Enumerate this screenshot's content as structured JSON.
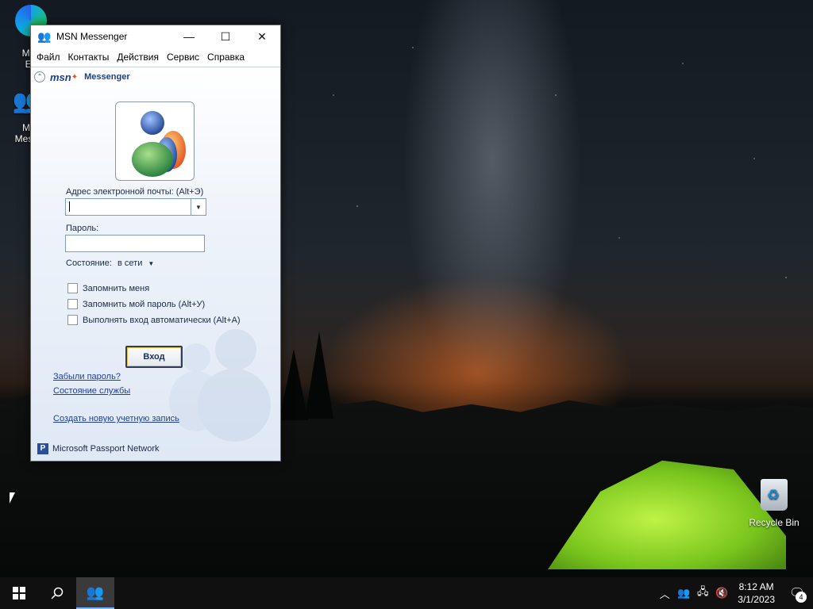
{
  "desktop": {
    "icons": [
      {
        "label": "Micr… Ed…",
        "line1": "Micr",
        "line2": "Ed"
      },
      {
        "label": "M… Mess…",
        "line1": "M",
        "line2": "Mess"
      },
      {
        "label": "Recycle Bin"
      }
    ]
  },
  "window": {
    "title": "MSN Messenger",
    "controls": {
      "minimize": "—",
      "maximize": "☐",
      "close": "✕"
    },
    "menu": [
      "Файл",
      "Контакты",
      "Действия",
      "Сервис",
      "Справка"
    ],
    "brand": {
      "msn": "msn",
      "product": "Messenger"
    },
    "email_label": "Адрес электронной почты: (Alt+Э)",
    "email_value": "",
    "password_label": "Пароль:",
    "status_label": "Состояние:",
    "status_value": "в сети",
    "checkboxes": [
      {
        "label": "Запомнить меня",
        "checked": false
      },
      {
        "label": "Запомнить мой пароль (Alt+У)",
        "checked": false
      },
      {
        "label": "Выполнять вход автоматически (Alt+А)",
        "checked": false
      }
    ],
    "login_button": "Вход",
    "links": {
      "forgot": "Забыли пароль?",
      "service_status": "Состояние службы",
      "create_account": "Создать новую учетную запись"
    },
    "footer": "Microsoft Passport Network"
  },
  "taskbar": {
    "time": "8:12 AM",
    "date": "3/1/2023",
    "notifications": "4"
  }
}
